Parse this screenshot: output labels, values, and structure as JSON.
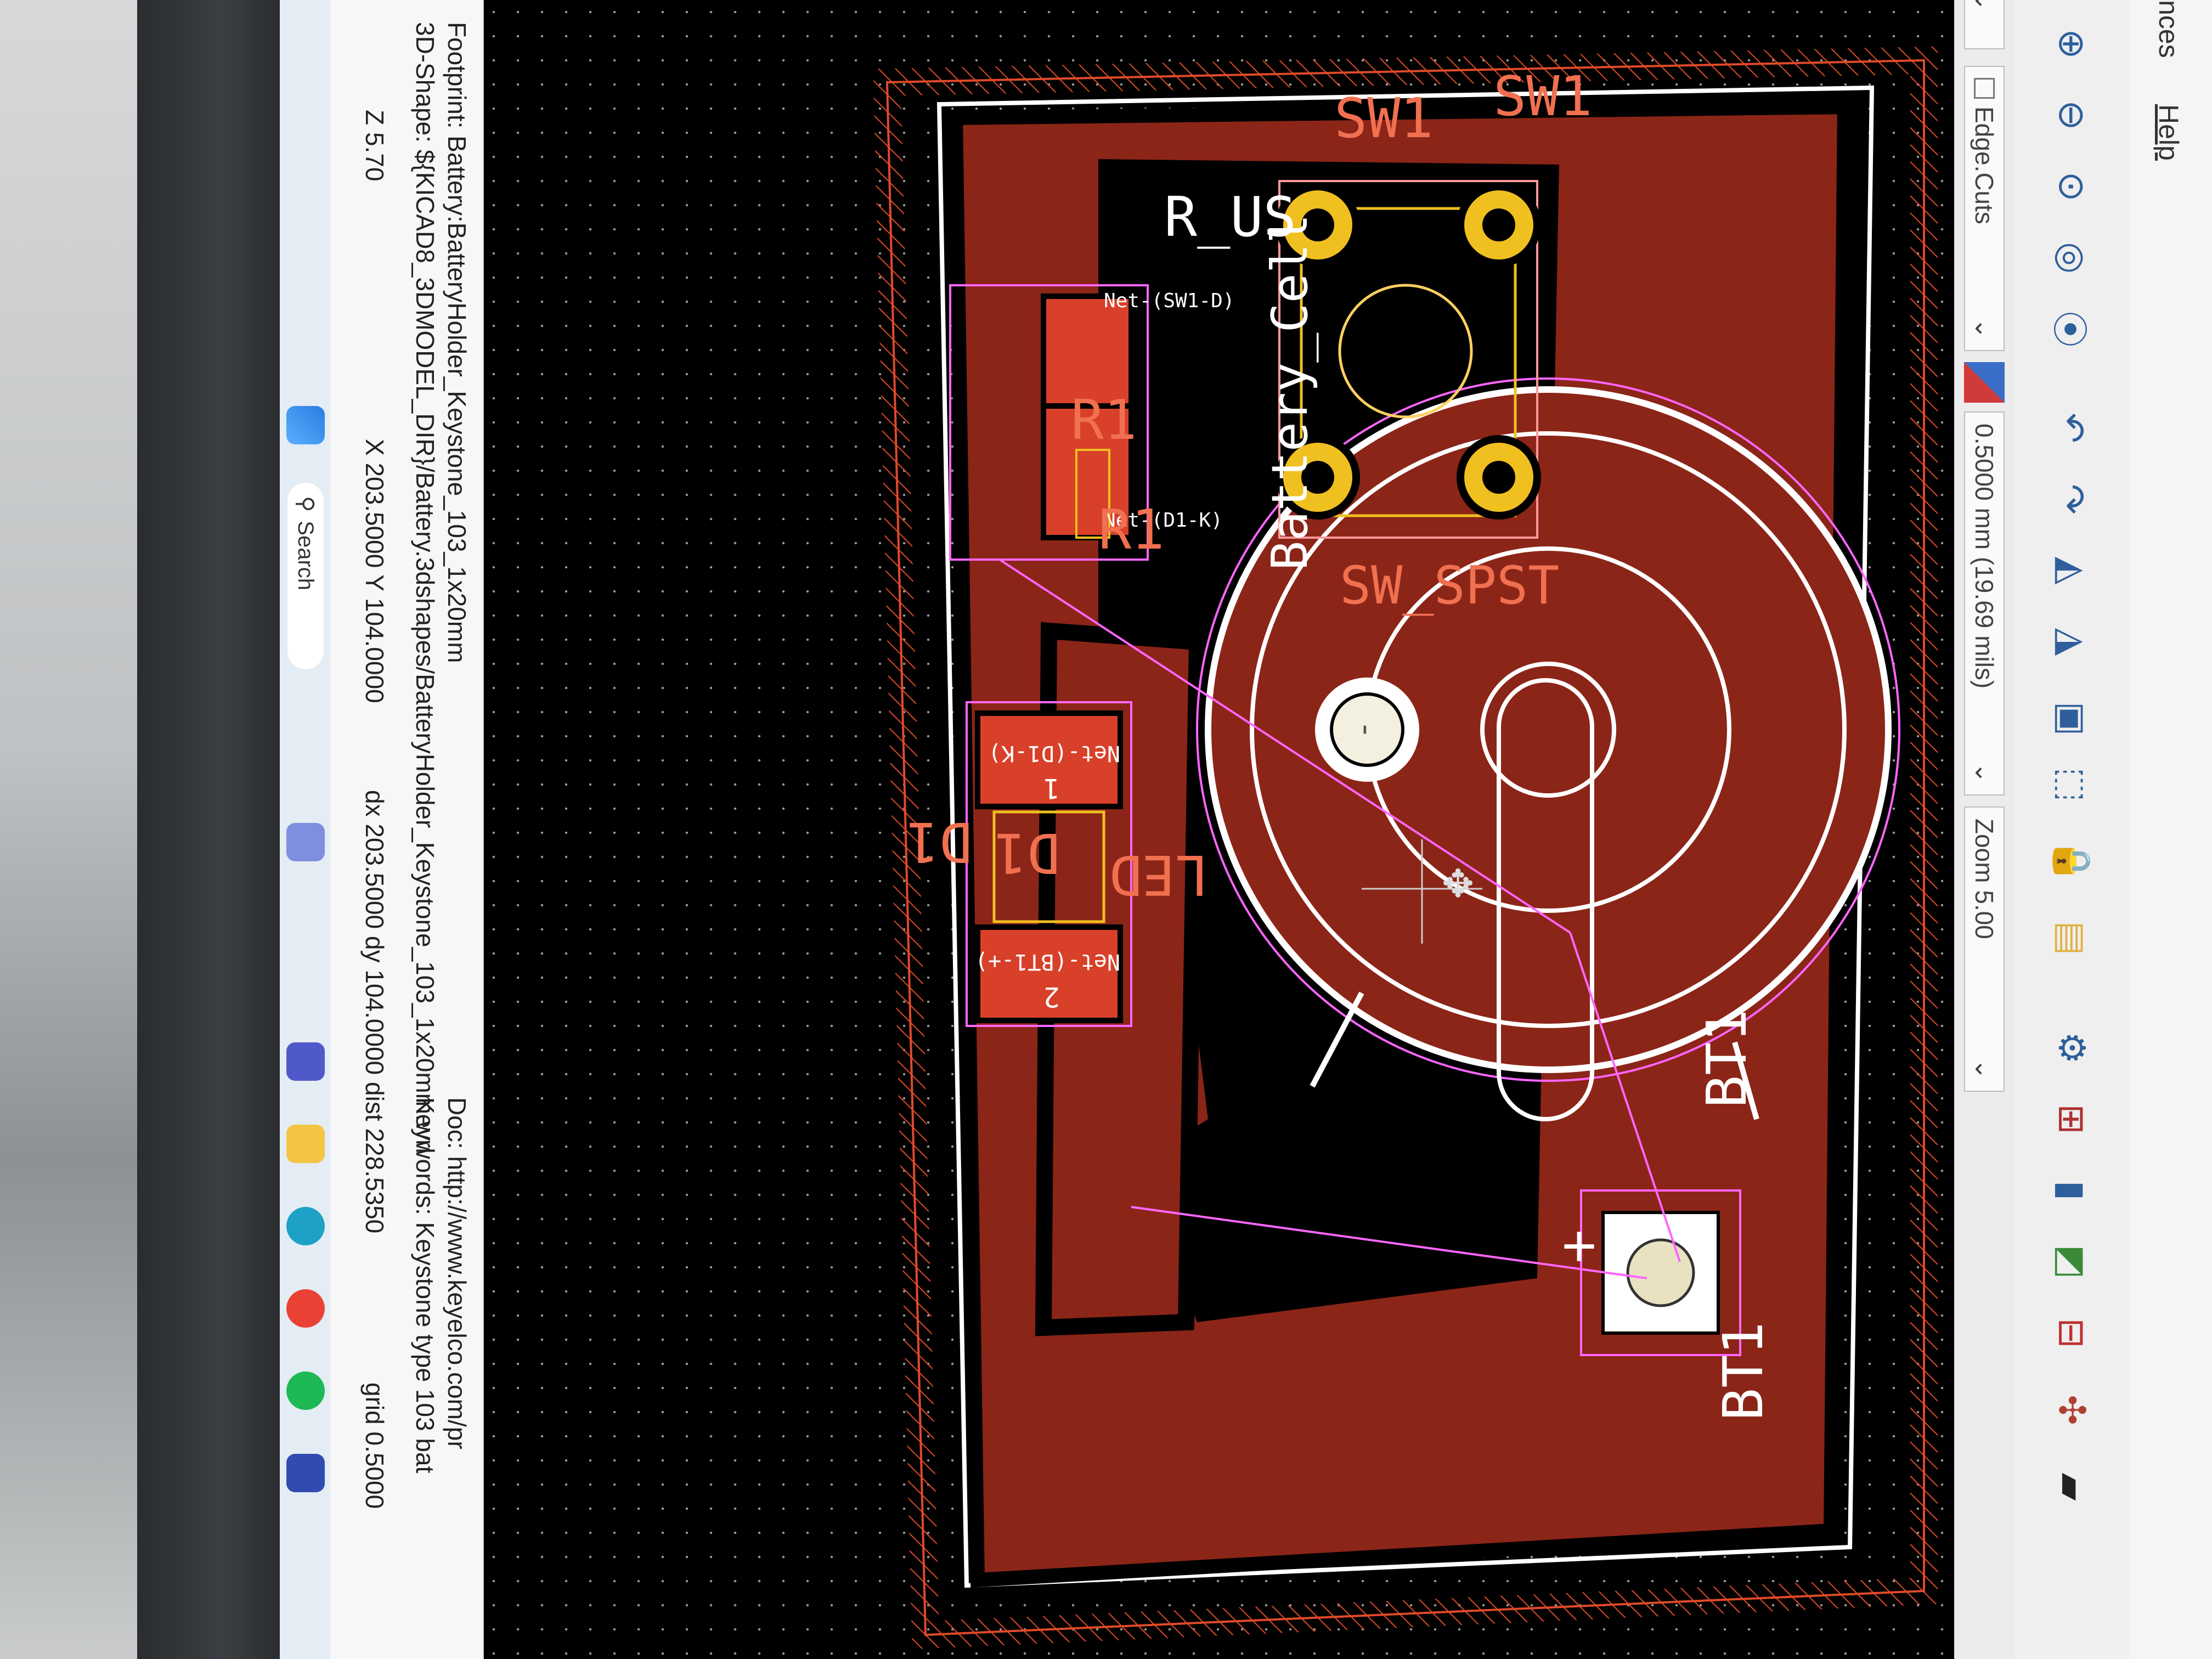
{
  "menu": {
    "items": [
      "nces",
      "Help"
    ]
  },
  "toolbar": {
    "tools": [
      "zoom-in",
      "zoom-out",
      "zoom-fit",
      "zoom-objects",
      "zoom-selection",
      "undo",
      "redo",
      "mirror-horizontal",
      "mirror-vertical",
      "group",
      "align",
      "lock",
      "pad-tool",
      "board-setup",
      "netlist",
      "drc",
      "footprint-editor",
      "footprint-wizard",
      "scripting",
      "terminal"
    ]
  },
  "options": {
    "layer": "Edge.Cuts",
    "grid": "0.5000 mm (19.69 mils)",
    "zoom": "Zoom 5.00"
  },
  "board": {
    "labels": {
      "sw1_ref": "SW1",
      "sw1_val": "SW1",
      "sw_value": "SW_SPST",
      "battery_value": "Battery_Cell",
      "r1_ref": "R1",
      "r1_val": "R1",
      "r_us": "R_US",
      "d1_ref": "D1",
      "d1_val": "D1",
      "led": "LED",
      "bt1_ref": "BT1",
      "bt1_val": "BT1",
      "net_sw1_d": "Net-(SW1-D)",
      "net_d1_k_r": "Net-(D1-K)",
      "net_d1_k": "Net-(D1-K)",
      "net_bt1": "Net-(BT1-+)",
      "pad1": "1",
      "pad2": "2",
      "plus": "+",
      "minus": "-"
    }
  },
  "status": {
    "footprint": "Footprint: Battery:BatteryHolder_Keystone_103_1x20mm",
    "shape3d": "3D-Shape: ${KICAD8_3DMODEL_DIR}/Battery.3dshapes/BatteryHolder_Keystone_103_1x20mm.wrl",
    "doc": "Doc: http://www.keyelco.com/pr",
    "keywords": "Keywords: Keystone type 103 bat",
    "z": "Z 5.70",
    "xy": "X 203.5000  Y 104.0000",
    "dxdy": "dx 203.5000  dy 104.0000  dist 228.5350",
    "grid": "grid 0.5000"
  },
  "taskbar": {
    "search": "Search"
  },
  "colors": {
    "copper": "#8b2518",
    "pad": "#f0c020",
    "outline": "#ffffff",
    "keepout": "#e04a2a",
    "courtyard": "#ff66ff"
  }
}
